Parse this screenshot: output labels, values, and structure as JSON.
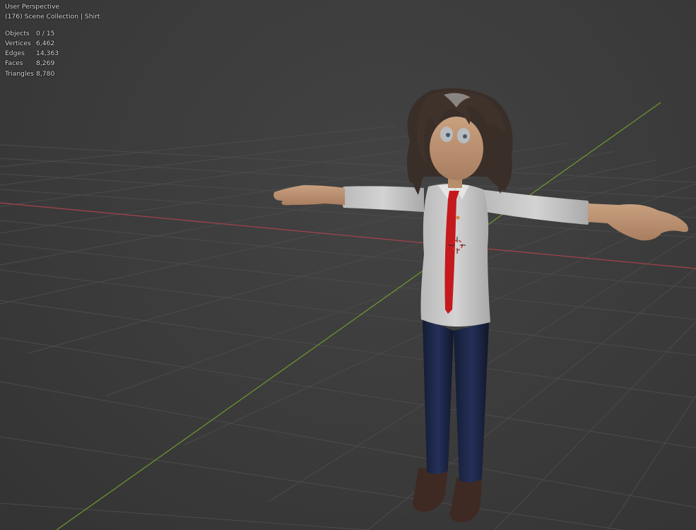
{
  "viewport": {
    "perspective_label": "User Perspective",
    "collection_label": "(176) Scene Collection | Shirt"
  },
  "stats": [
    {
      "label": "Objects",
      "value": "0 / 15"
    },
    {
      "label": "Vertices",
      "value": "6,462"
    },
    {
      "label": "Edges",
      "value": "14,363"
    },
    {
      "label": "Faces",
      "value": "8,269"
    },
    {
      "label": "Triangles",
      "value": "8,780"
    }
  ],
  "colors": {
    "background": "#3d3d3d",
    "grid_line": "#4b4b4b",
    "x_axis": "#a8434a",
    "y_axis": "#6e9a2e",
    "shirt": "#c9c9c9",
    "tie": "#c41a1e",
    "skin": "#c09472",
    "hair": "#3a2e28",
    "pants": "#1c2744",
    "shoes": "#3e2a22",
    "cursor_red": "#e0242a"
  },
  "icons": [
    "3d-cursor-icon"
  ]
}
